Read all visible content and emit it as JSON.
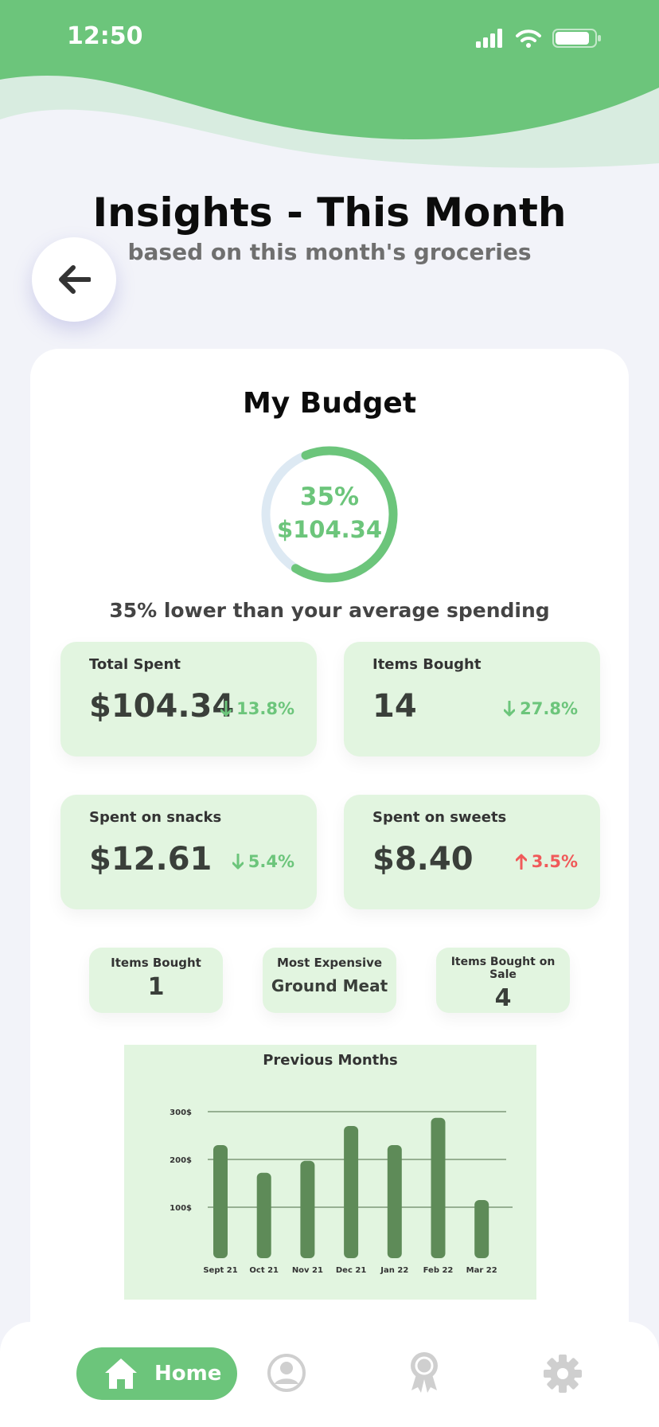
{
  "status_bar": {
    "time": "12:50"
  },
  "header": {
    "title": "Insights - This Month",
    "subtitle": "based on this month's groceries"
  },
  "budget": {
    "title": "My Budget",
    "percent_label": "35%",
    "percent_value": 0.65,
    "amount": "$104.34",
    "note": "35% lower than your average spending",
    "colors": {
      "accent": "#6cc57b",
      "track": "#dde9f3"
    }
  },
  "stats": [
    {
      "label": "Total Spent",
      "value": "$104.34",
      "change": "13.8%",
      "direction": "down"
    },
    {
      "label": "Items Bought",
      "value": "14",
      "change": "27.8%",
      "direction": "down"
    },
    {
      "label": "Spent on snacks",
      "value": "$12.61",
      "change": "5.4%",
      "direction": "down"
    },
    {
      "label": "Spent on sweets",
      "value": "$8.40",
      "change": "3.5%",
      "direction": "up"
    }
  ],
  "mini_stats": [
    {
      "label": "Items Bought",
      "value": "1"
    },
    {
      "label": "Most Expensive",
      "value": "Ground Meat"
    },
    {
      "label": "Items Bought on Sale",
      "value": "4"
    }
  ],
  "chart_data": {
    "type": "bar",
    "title": "Previous Months",
    "categories": [
      "Sept 21",
      "Oct 21",
      "Nov 21",
      "Dec 21",
      "Jan 22",
      "Feb 22",
      "Mar 22"
    ],
    "values": [
      230,
      172,
      197,
      270,
      230,
      287,
      115
    ],
    "yticks": [
      "100$",
      "200$",
      "300$"
    ],
    "ylim": [
      0,
      300
    ],
    "grid": true,
    "bar_color": "#5e8b58"
  },
  "tabbar": {
    "home_label": "Home",
    "icons": [
      "home-icon",
      "profile-icon",
      "award-icon",
      "settings-icon"
    ]
  }
}
